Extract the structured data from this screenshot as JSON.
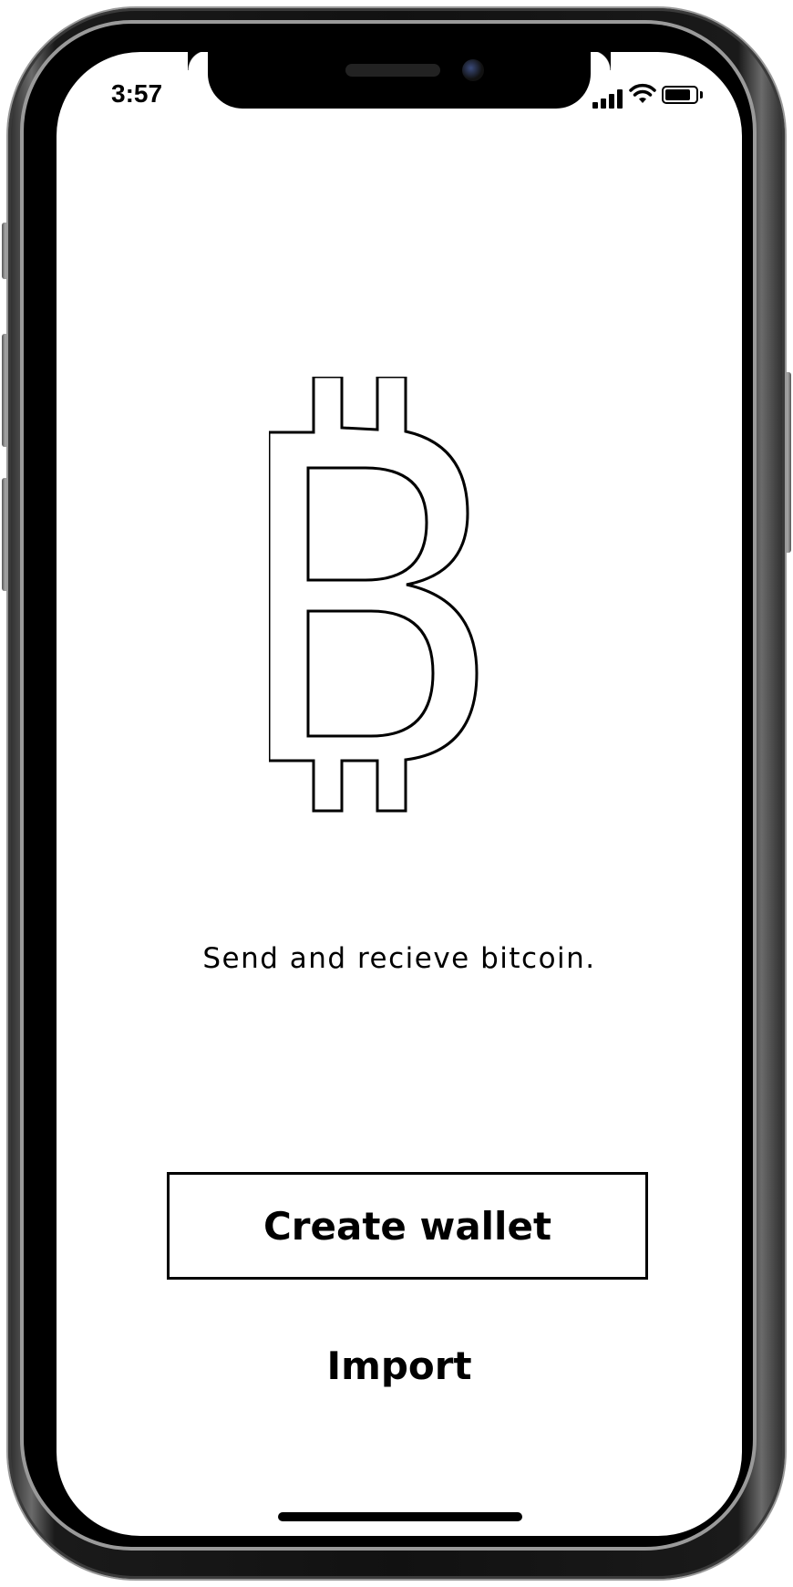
{
  "status_bar": {
    "time": "3:57",
    "signal_icon": "cellular-signal-icon",
    "wifi_icon": "wifi-icon",
    "battery_icon": "battery-icon",
    "battery_level": 0.85
  },
  "main": {
    "logo_icon": "bitcoin-icon",
    "tagline": "Send and recieve bitcoin.",
    "create_wallet_label": "Create wallet",
    "import_label": "Import"
  },
  "colors": {
    "background": "#ffffff",
    "foreground": "#000000"
  }
}
